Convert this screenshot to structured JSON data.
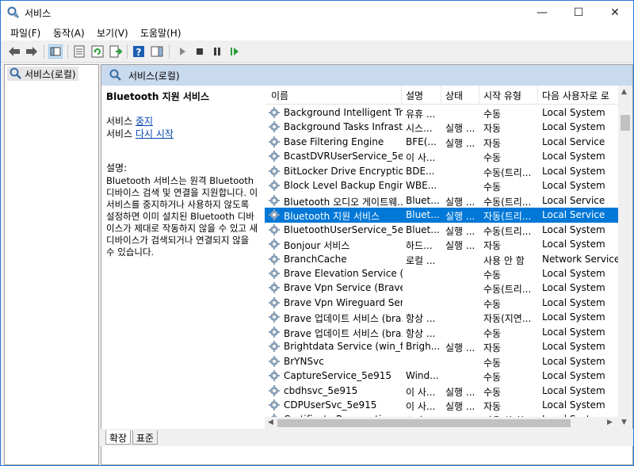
{
  "window": {
    "title": "서비스",
    "min": "—",
    "max": "☐",
    "close": "✕"
  },
  "menu": [
    "파일(F)",
    "동작(A)",
    "보기(V)",
    "도움말(H)"
  ],
  "toolbar": {
    "icons": [
      "back-arrow-icon",
      "forward-arrow-icon",
      "show-hide-console-tree-icon",
      "properties-icon",
      "refresh-icon",
      "export-list-icon",
      "help-icon",
      "show-hide-action-pane-icon",
      "start-service-icon",
      "stop-service-icon",
      "pause-service-icon",
      "restart-service-icon"
    ]
  },
  "tree": {
    "item": "서비스(로컬)"
  },
  "banner": {
    "title": "서비스(로컬)"
  },
  "description": {
    "service_title": "Bluetooth 지원 서비스",
    "stop_prefix": "서비스 ",
    "stop_link": "중지",
    "restart_prefix": "서비스 ",
    "restart_link": "다시 시작",
    "desc_label": "설명:",
    "desc_text": "Bluetooth 서비스는 원격 Bluetooth 디바이스 검색 및 연결을 지원합니다. 이 서비스를 중지하거나 사용하지 않도록 설정하면 이미 설치된 Bluetooth 디바이스가 제대로 작동하지 않을 수 있고 새 디바이스가 검색되거나 연결되지 않을 수 있습니다."
  },
  "columns": [
    "이름",
    "설명",
    "상태",
    "시작 유형",
    "다음 사용자로 로"
  ],
  "rows": [
    {
      "name": "Background Intelligent Tra...",
      "desc": "유휴 ...",
      "status": "",
      "startup": "수동",
      "logon": "Local System"
    },
    {
      "name": "Background Tasks Infrastru...",
      "desc": "시스...",
      "status": "실행 ...",
      "startup": "자동",
      "logon": "Local System"
    },
    {
      "name": "Base Filtering Engine",
      "desc": "BFE(...",
      "status": "실행 ...",
      "startup": "자동",
      "logon": "Local Service"
    },
    {
      "name": "BcastDVRUserService_5e915",
      "desc": "이 사...",
      "status": "",
      "startup": "수동",
      "logon": "Local System"
    },
    {
      "name": "BitLocker Drive Encryption ...",
      "desc": "BDE...",
      "status": "",
      "startup": "수동(트리...",
      "logon": "Local System"
    },
    {
      "name": "Block Level Backup Engine ...",
      "desc": "WBE...",
      "status": "",
      "startup": "수동",
      "logon": "Local System"
    },
    {
      "name": "Bluetooth 오디오 게이트웨...",
      "desc": "Bluet...",
      "status": "실행 ...",
      "startup": "수동(트리...",
      "logon": "Local Service"
    },
    {
      "name": "Bluetooth 지원 서비스",
      "desc": "Bluet...",
      "status": "실행 ...",
      "startup": "자동(트리...",
      "logon": "Local Service",
      "selected": true
    },
    {
      "name": "BluetoothUserService_5e915",
      "desc": "Bluet...",
      "status": "실행 ...",
      "startup": "수동(트리...",
      "logon": "Local System"
    },
    {
      "name": "Bonjour 서비스",
      "desc": "하드...",
      "status": "실행 ...",
      "startup": "자동",
      "logon": "Local System"
    },
    {
      "name": "BranchCache",
      "desc": "로컬 ...",
      "status": "",
      "startup": "사용 안 함",
      "logon": "Network Service"
    },
    {
      "name": "Brave Elevation Service (Br...",
      "desc": "",
      "status": "",
      "startup": "수동",
      "logon": "Local System"
    },
    {
      "name": "Brave Vpn Service (BraveV...",
      "desc": "",
      "status": "",
      "startup": "수동(트리...",
      "logon": "Local System"
    },
    {
      "name": "Brave Vpn Wireguard Servi...",
      "desc": "",
      "status": "",
      "startup": "수동",
      "logon": "Local System"
    },
    {
      "name": "Brave 업데이트 서비스 (bra...",
      "desc": "항상 ...",
      "status": "",
      "startup": "자동(지연...",
      "logon": "Local System"
    },
    {
      "name": "Brave 업데이트 서비스 (bra...",
      "desc": "항상 ...",
      "status": "",
      "startup": "수동",
      "logon": "Local System"
    },
    {
      "name": "Brightdata Service (win_for...",
      "desc": "Brigh...",
      "status": "실행 ...",
      "startup": "자동",
      "logon": "Local System"
    },
    {
      "name": "BrYNSvc",
      "desc": "",
      "status": "",
      "startup": "수동",
      "logon": "Local System"
    },
    {
      "name": "CaptureService_5e915",
      "desc": "Wind...",
      "status": "",
      "startup": "수동",
      "logon": "Local System"
    },
    {
      "name": "cbdhsvc_5e915",
      "desc": "이 사...",
      "status": "실행 ...",
      "startup": "수동",
      "logon": "Local System"
    },
    {
      "name": "CDPUserSvc_5e915",
      "desc": "이 사...",
      "status": "실행 ...",
      "startup": "자동",
      "logon": "Local System"
    },
    {
      "name": "Certificate Propagation",
      "desc": "스마...",
      "status": "",
      "startup": "사용 안 함",
      "logon": "Local System"
    }
  ],
  "tabs": [
    "확장",
    "표준"
  ],
  "colors": {
    "selection": "#0078d7",
    "banner": "#c9d9ee",
    "link": "#0645ad"
  }
}
